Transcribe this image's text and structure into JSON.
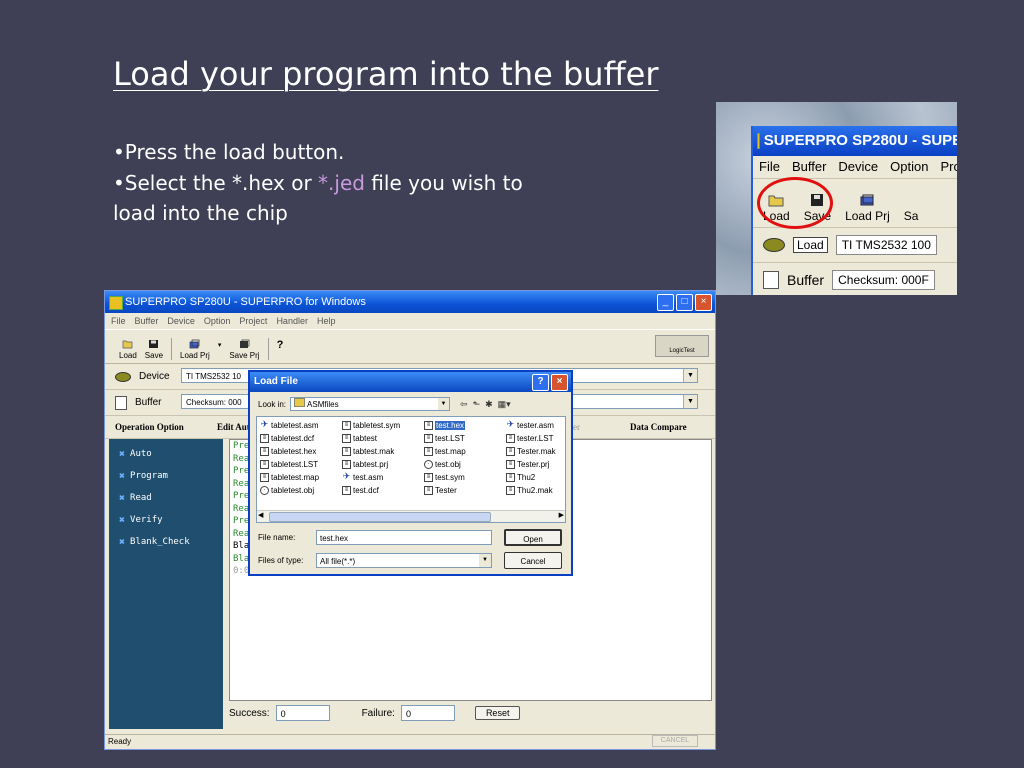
{
  "slide": {
    "title": "Load your program into the buffer",
    "bullet1": "•Press the load button.",
    "bullet2_pre": "•Select the *.hex or ",
    "bullet2_jed": "*.jed",
    "bullet2_post": " file you wish to load into the chip"
  },
  "zoom": {
    "title": "SUPERPRO SP280U - SUPER",
    "menu": [
      "File",
      "Buffer",
      "Device",
      "Option",
      "Proje"
    ],
    "toolbar": {
      "load": "Load",
      "save": "Save",
      "load_prj": "Load Prj",
      "more": "Sa"
    },
    "device_button": "Load",
    "device_value": "TI TMS2532 100",
    "buffer_label": "Buffer",
    "checksum": "Checksum: 000F"
  },
  "app": {
    "title": "SUPERPRO SP280U - SUPERPRO for Windows",
    "menu": [
      "File",
      "Buffer",
      "Device",
      "Option",
      "Project",
      "Handler",
      "Help"
    ],
    "toolbar": {
      "load": "Load",
      "save": "Save",
      "load_prj": "Load Prj",
      "save_prj": "Save Prj",
      "help": "?"
    },
    "logictest": "LogicTest",
    "device_label": "Device",
    "device_value": "TI TMS2532 10",
    "buffer_label": "Buffer",
    "checksum": "Checksum: 000",
    "headers": {
      "operation_option": "Operation Option",
      "edit_auto": "Edit Aut",
      "tester": "ster",
      "data_compare": "Data Compare"
    },
    "operations": [
      "Auto",
      "Program",
      "Read",
      "Verify",
      "Blank_Check"
    ],
    "log": [
      "Pre",
      "Rea",
      "Pre",
      "Rea",
      "Pre",
      "Rea",
      "Pre",
      "Rea",
      "Bla",
      "Bla",
      "0:0"
    ],
    "success_label": "Success:",
    "success_value": "0",
    "failure_label": "Failure:",
    "failure_value": "0",
    "reset": "Reset",
    "status": "Ready",
    "cancel": "CANCEL"
  },
  "dialog": {
    "title": "Load File",
    "help": "?",
    "look_in_label": "Look in:",
    "look_in_value": "ASMfiles",
    "files": [
      [
        "tabletest.asm",
        "tabletest.dcf",
        "tabletest.hex",
        "tabletest.LST",
        "tabletest.map",
        "tabletest.obj"
      ],
      [
        "tabletest.sym",
        "tabtest",
        "tabtest.mak",
        "tabtest.prj",
        "test.asm",
        "test.dcf"
      ],
      [
        "test.hex",
        "test.LST",
        "test.map",
        "test.obj",
        "test.sym",
        "Tester"
      ],
      [
        "tester.asm",
        "tester.LST",
        "Tester.mak",
        "Tester.prj",
        "Thu2",
        "Thu2.mak"
      ]
    ],
    "selected_file": "test.hex",
    "file_name_label": "File name:",
    "file_name_value": "test.hex",
    "file_type_label": "Files of type:",
    "file_type_value": "All file(*.*)",
    "open": "Open",
    "cancel": "Cancel"
  }
}
